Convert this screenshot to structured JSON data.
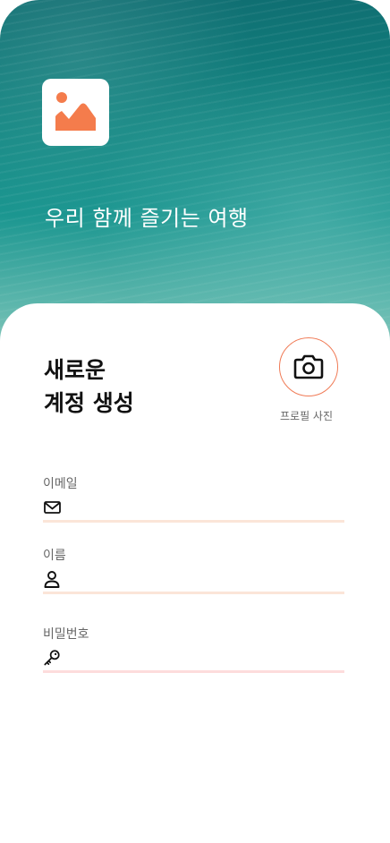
{
  "hero": {
    "tagline": "우리 함께 즐기는 여행",
    "logo_icon": "mountain-sun-logo-icon",
    "accent_color": "#f47c4c"
  },
  "form": {
    "title_line1": "새로운",
    "title_line2": "계정 생성",
    "profile_photo_label": "프로필 사진",
    "profile_photo_icon": "camera-icon",
    "fields": [
      {
        "label": "이메일",
        "icon": "mail-icon",
        "value": "",
        "placeholder": ""
      },
      {
        "label": "이름",
        "icon": "person-icon",
        "value": "",
        "placeholder": ""
      },
      {
        "label": "비밀번호",
        "icon": "key-icon",
        "value": "",
        "placeholder": ""
      }
    ]
  }
}
